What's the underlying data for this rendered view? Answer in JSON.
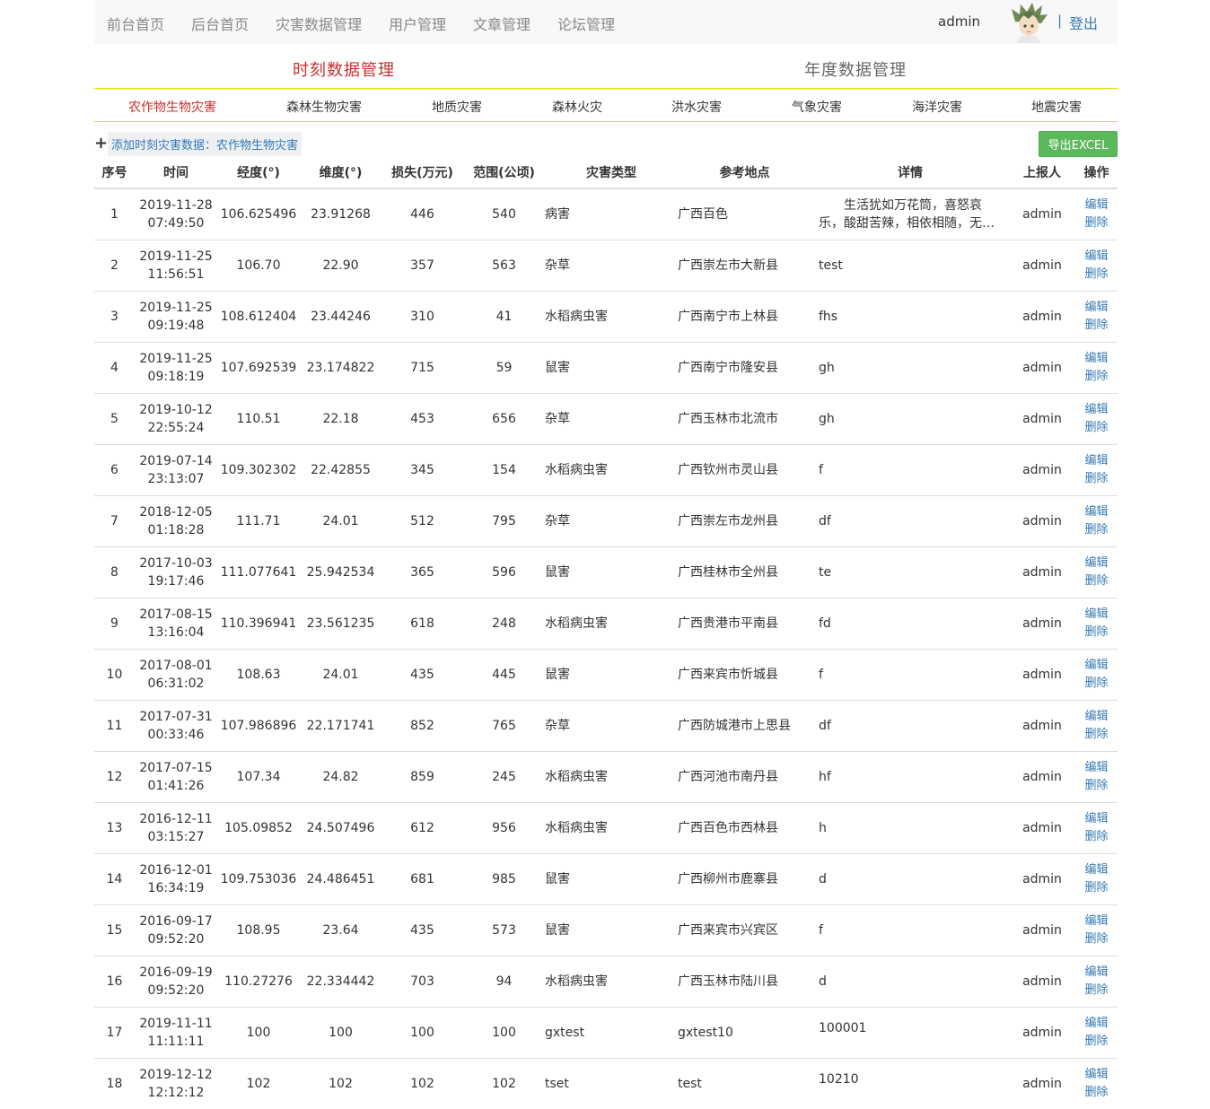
{
  "nav": {
    "items": [
      "前台首页",
      "后台首页",
      "灾害数据管理",
      "用户管理",
      "文章管理",
      "论坛管理"
    ],
    "user": "admin",
    "separator": "|",
    "logout": "登出"
  },
  "section_tabs": {
    "active": "时刻数据管理",
    "inactive": "年度数据管理"
  },
  "categories": [
    "农作物生物灾害",
    "森林生物灾害",
    "地质灾害",
    "森林火灾",
    "洪水灾害",
    "气象灾害",
    "海洋灾害",
    "地震灾害"
  ],
  "active_category": "农作物生物灾害",
  "toolbar": {
    "add_label": "添加时刻灾害数据：农作物生物灾害",
    "export_label": "导出EXCEL"
  },
  "table": {
    "headers": [
      "序号",
      "时间",
      "经度(°)",
      "维度(°)",
      "损失(万元)",
      "范围(公顷)",
      "灾害类型",
      "参考地点",
      "详情",
      "上报人",
      "操作"
    ],
    "edit_label": "编辑",
    "delete_label": "删除",
    "rows": [
      {
        "no": "1",
        "date": "2019-11-28",
        "time": "07:49:50",
        "lng": "106.625496",
        "lat": "23.91268",
        "loss": "446",
        "area": "540",
        "type": "病害",
        "place": "广西百色",
        "detail": "　　生活犹如万花筒，喜怒哀乐，酸甜苦辣，相依相随，无须过于执着",
        "reporter": "admin"
      },
      {
        "no": "2",
        "date": "2019-11-25",
        "time": "11:56:51",
        "lng": "106.70",
        "lat": "22.90",
        "loss": "357",
        "area": "563",
        "type": "杂草",
        "place": "广西崇左市大新县",
        "detail": "test",
        "reporter": "admin"
      },
      {
        "no": "3",
        "date": "2019-11-25",
        "time": "09:19:48",
        "lng": "108.612404",
        "lat": "23.44246",
        "loss": "310",
        "area": "41",
        "type": "水稻病虫害",
        "place": "广西南宁市上林县",
        "detail": "fhs",
        "reporter": "admin"
      },
      {
        "no": "4",
        "date": "2019-11-25",
        "time": "09:18:19",
        "lng": "107.692539",
        "lat": "23.174822",
        "loss": "715",
        "area": "59",
        "type": "鼠害",
        "place": "广西南宁市隆安县",
        "detail": "gh",
        "reporter": "admin"
      },
      {
        "no": "5",
        "date": "2019-10-12",
        "time": "22:55:24",
        "lng": "110.51",
        "lat": "22.18",
        "loss": "453",
        "area": "656",
        "type": "杂草",
        "place": "广西玉林市北流市",
        "detail": "gh",
        "reporter": "admin"
      },
      {
        "no": "6",
        "date": "2019-07-14",
        "time": "23:13:07",
        "lng": "109.302302",
        "lat": "22.42855",
        "loss": "345",
        "area": "154",
        "type": "水稻病虫害",
        "place": "广西钦州市灵山县",
        "detail": "f",
        "reporter": "admin"
      },
      {
        "no": "7",
        "date": "2018-12-05",
        "time": "01:18:28",
        "lng": "111.71",
        "lat": "24.01",
        "loss": "512",
        "area": "795",
        "type": "杂草",
        "place": "广西崇左市龙州县",
        "detail": "df",
        "reporter": "admin"
      },
      {
        "no": "8",
        "date": "2017-10-03",
        "time": "19:17:46",
        "lng": "111.077641",
        "lat": "25.942534",
        "loss": "365",
        "area": "596",
        "type": "鼠害",
        "place": "广西桂林市全州县",
        "detail": "te",
        "reporter": "admin"
      },
      {
        "no": "9",
        "date": "2017-08-15",
        "time": "13:16:04",
        "lng": "110.396941",
        "lat": "23.561235",
        "loss": "618",
        "area": "248",
        "type": "水稻病虫害",
        "place": "广西贵港市平南县",
        "detail": "fd",
        "reporter": "admin"
      },
      {
        "no": "10",
        "date": "2017-08-01",
        "time": "06:31:02",
        "lng": "108.63",
        "lat": "24.01",
        "loss": "435",
        "area": "445",
        "type": "鼠害",
        "place": "广西来宾市忻城县",
        "detail": "f",
        "reporter": "admin"
      },
      {
        "no": "11",
        "date": "2017-07-31",
        "time": "00:33:46",
        "lng": "107.986896",
        "lat": "22.171741",
        "loss": "852",
        "area": "765",
        "type": "杂草",
        "place": "广西防城港市上思县",
        "detail": "df",
        "reporter": "admin"
      },
      {
        "no": "12",
        "date": "2017-07-15",
        "time": "01:41:26",
        "lng": "107.34",
        "lat": "24.82",
        "loss": "859",
        "area": "245",
        "type": "水稻病虫害",
        "place": "广西河池市南丹县",
        "detail": "hf",
        "reporter": "admin"
      },
      {
        "no": "13",
        "date": "2016-12-11",
        "time": "03:15:27",
        "lng": "105.09852",
        "lat": "24.507496",
        "loss": "612",
        "area": "956",
        "type": "水稻病虫害",
        "place": "广西百色市西林县",
        "detail": "h",
        "reporter": "admin"
      },
      {
        "no": "14",
        "date": "2016-12-01",
        "time": "16:34:19",
        "lng": "109.753036",
        "lat": "24.486451",
        "loss": "681",
        "area": "985",
        "type": "鼠害",
        "place": "广西柳州市鹿寨县",
        "detail": "d",
        "reporter": "admin"
      },
      {
        "no": "15",
        "date": "2016-09-17",
        "time": "09:52:20",
        "lng": "108.95",
        "lat": "23.64",
        "loss": "435",
        "area": "573",
        "type": "鼠害",
        "place": "广西来宾市兴宾区",
        "detail": "f",
        "reporter": "admin"
      },
      {
        "no": "16",
        "date": "2016-09-19",
        "time": "09:52:20",
        "lng": "110.27276",
        "lat": "22.334442",
        "loss": "703",
        "area": "94",
        "type": "水稻病虫害",
        "place": "广西玉林市陆川县",
        "detail": "d",
        "reporter": "admin"
      },
      {
        "no": "17",
        "date": "2019-11-11",
        "time": "11:11:11",
        "lng": "100",
        "lat": "100",
        "loss": "100",
        "area": "100",
        "type": "gxtest",
        "place": "gxtest10",
        "detail": "100001",
        "reporter": "admin",
        "detail_top": true
      },
      {
        "no": "18",
        "date": "2019-12-12",
        "time": "12:12:12",
        "lng": "102",
        "lat": "102",
        "loss": "102",
        "area": "102",
        "type": "tset",
        "place": "test",
        "detail": "10210",
        "reporter": "admin",
        "detail_top": true
      }
    ]
  },
  "colors": {
    "active_red": "#c9302c",
    "link_blue": "#337ab7",
    "export_green": "#5cb85c",
    "divider_yellow": "#e6e000"
  }
}
